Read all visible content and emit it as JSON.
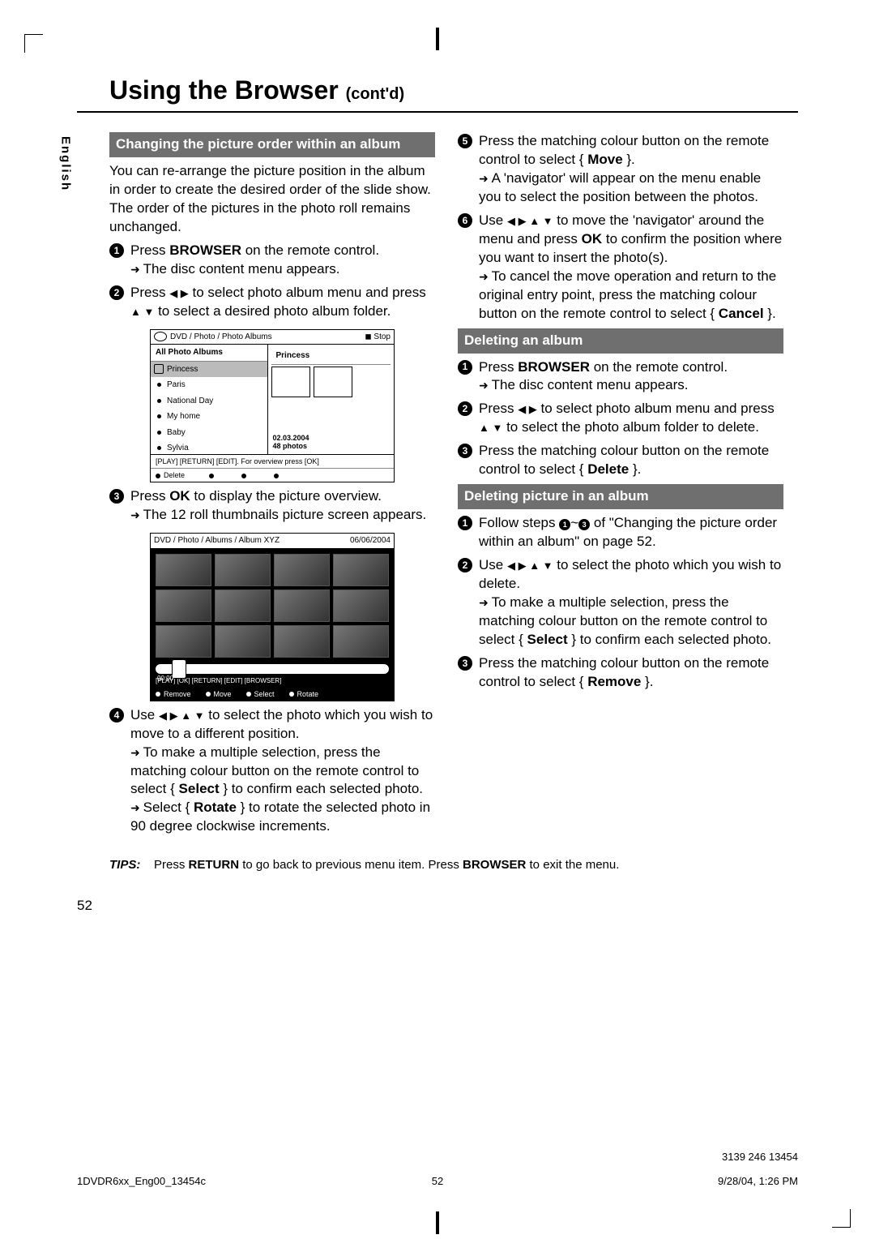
{
  "title_main": "Using the Browser",
  "title_cont": "(cont'd)",
  "lang_tab": "English",
  "left": {
    "sect1": "Changing the picture order within an album",
    "intro": "You can re-arrange the picture position in the album in order to create the desired order of the slide show.  The order of the pictures in the photo roll remains unchanged.",
    "s1a": "Press ",
    "s1b": "BROWSER",
    "s1c": " on the remote control.",
    "s1res": "The disc content menu appears.",
    "s2a": "Press ",
    "s2b": "◀ ▶",
    "s2c": " to select photo album menu and press ",
    "s2d": "▲ ▼",
    "s2e": " to select a desired photo album folder.",
    "s3a": "Press ",
    "s3b": "OK",
    "s3c": " to display the picture overview.",
    "s3res": "The 12 roll thumbnails picture screen appears.",
    "s4a": "Use ",
    "s4b": "◀ ▶ ▲ ▼",
    "s4c": "  to select the photo which you wish to move to a different position.",
    "s4res1a": "To make a multiple selection, press the matching colour button on the remote control to select { ",
    "s4res1b": "Select",
    "s4res1c": " } to confirm each selected photo.",
    "s4res2a": "Select { ",
    "s4res2b": "Rotate",
    "s4res2c": " } to rotate the selected photo in 90 degree clockwise increments."
  },
  "right": {
    "s5a": "Press the matching colour button on the remote control to select { ",
    "s5b": "Move",
    "s5c": " }.",
    "s5res": "A 'navigator' will appear on the menu enable you to select the position between the photos.",
    "s6a": "Use ",
    "s6b": "◀ ▶ ▲ ▼",
    "s6c": "  to move the 'navigator' around the menu and press ",
    "s6d": "OK",
    "s6e": " to confirm the position where you want to insert the photo(s).",
    "s6res1": "To cancel the move operation and return to the original entry point, press the matching colour button on the remote control to select { ",
    "s6res1b": "Cancel",
    "s6res1c": " }.",
    "sect2": "Deleting an album",
    "d1a": "Press ",
    "d1b": "BROWSER",
    "d1c": " on the remote control.",
    "d1res": "The disc content menu appears.",
    "d2a": "Press ",
    "d2b": "◀ ▶",
    "d2c": " to select photo album menu and press ",
    "d2d": "▲ ▼",
    "d2e": " to select the photo album folder to delete.",
    "d3a": "Press the matching colour button on the remote control to select { ",
    "d3b": "Delete",
    "d3c": " }.",
    "sect3": "Deleting picture in an album",
    "p1a": "Follow steps ",
    "p1b": "~",
    "p1c": " of \"Changing the picture order within an album\" on page 52.",
    "p2a": "Use ",
    "p2b": "◀ ▶ ▲ ▼",
    "p2c": "  to select the photo which you wish to delete.",
    "p2res1a": "To make a multiple selection, press the matching colour button on the remote control to select { ",
    "p2res1b": "Select",
    "p2res1c": " } to confirm each selected photo.",
    "p3a": "Press the matching colour button on the remote control to select { ",
    "p3b": "Remove",
    "p3c": " }."
  },
  "shot1": {
    "crumb": "DVD / Photo / Photo Albums",
    "stop": "◼ Stop",
    "left_title": "All Photo Albums",
    "items": [
      "Princess",
      "Paris",
      "National Day",
      "My home",
      "Baby",
      "Sylvia"
    ],
    "right_title": "Princess",
    "date": "02.03.2004",
    "count": "48 photos",
    "hint": "[PLAY] [RETURN] [EDIT].  For overview press [OK]",
    "action": "Delete"
  },
  "shot2": {
    "crumb": "DVD / Photo / Albums / Album XYZ",
    "date": "06/06/2004",
    "time": "00:00",
    "hint": "[PLAY] [OK] [RETURN] [EDIT] [BROWSER]",
    "actions": [
      "Remove",
      "Move",
      "Select",
      "Rotate"
    ]
  },
  "tips_label": "TIPS:",
  "tips_a": "Press ",
  "tips_b": "RETURN",
  "tips_c": " to go back to previous menu item.  Press ",
  "tips_d": "BROWSER",
  "tips_e": " to exit the menu.",
  "page_number": "52",
  "footer_file": "1DVDR6xx_Eng00_13454c",
  "footer_pg": "52",
  "footer_dt": "9/28/04, 1:26 PM",
  "part_no": "3139 246 13454"
}
